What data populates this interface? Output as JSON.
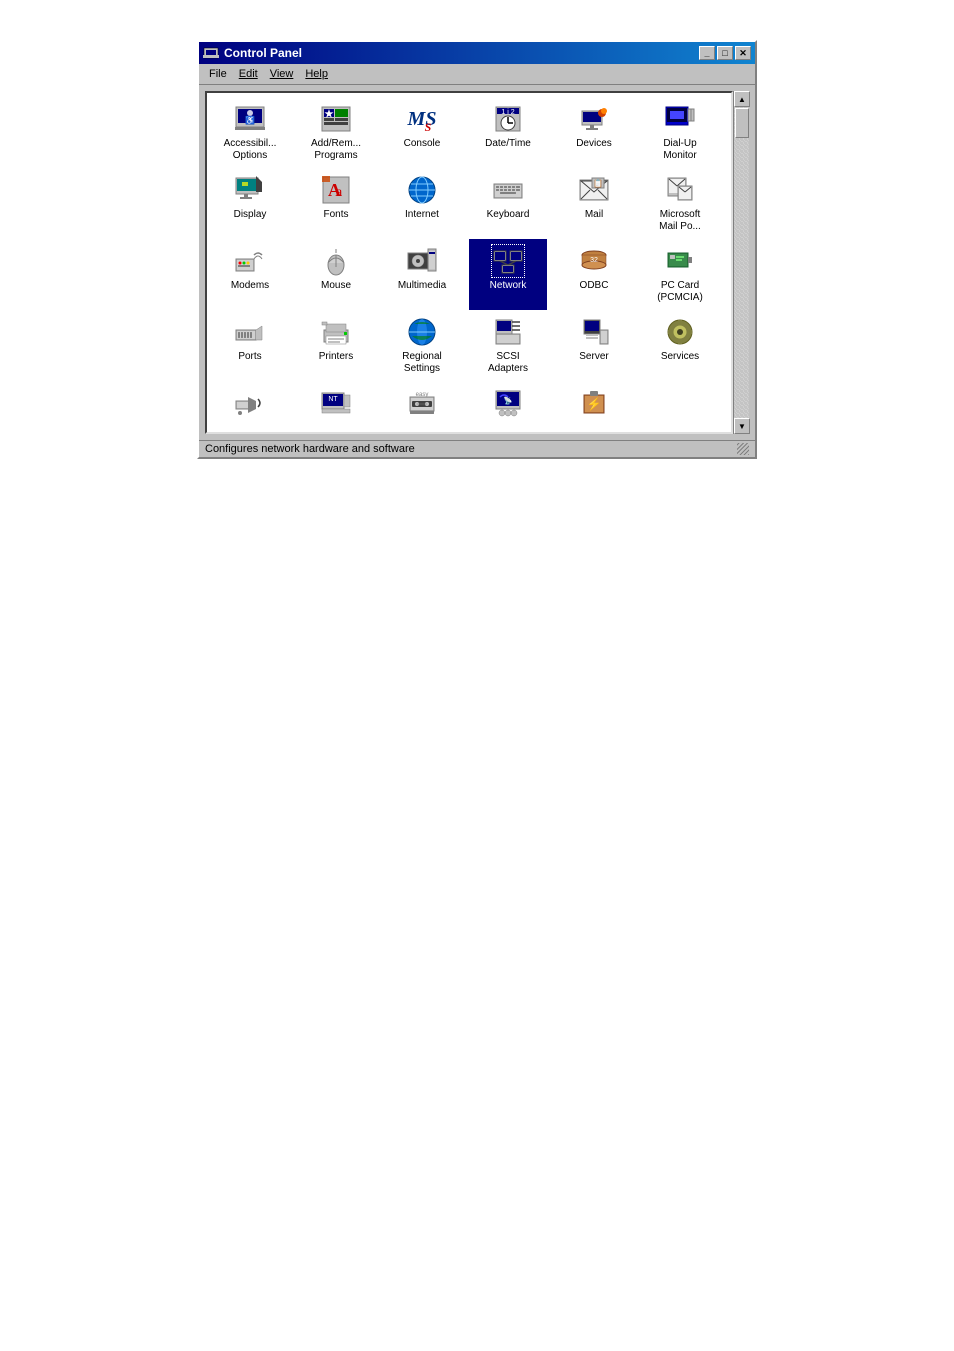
{
  "window": {
    "title": "Control Panel",
    "title_icon": "🖥",
    "min_btn": "_",
    "max_btn": "□",
    "close_btn": "✕"
  },
  "menu": {
    "items": [
      "File",
      "Edit",
      "View",
      "Help"
    ]
  },
  "icons": [
    {
      "id": "accessibility",
      "label": "Accessibil...\nOptions",
      "selected": false
    },
    {
      "id": "add-remove",
      "label": "Add/Rem...\nPrograms",
      "selected": false
    },
    {
      "id": "console",
      "label": "Console",
      "selected": false
    },
    {
      "id": "datetime",
      "label": "Date/Time",
      "selected": false
    },
    {
      "id": "devices",
      "label": "Devices",
      "selected": false
    },
    {
      "id": "dialup",
      "label": "Dial-Up\nMonitor",
      "selected": false
    },
    {
      "id": "display",
      "label": "Display",
      "selected": false
    },
    {
      "id": "fonts",
      "label": "Fonts",
      "selected": false
    },
    {
      "id": "internet",
      "label": "Internet",
      "selected": false
    },
    {
      "id": "keyboard",
      "label": "Keyboard",
      "selected": false
    },
    {
      "id": "mail",
      "label": "Mail",
      "selected": false
    },
    {
      "id": "ms-mail",
      "label": "Microsoft\nMail Po...",
      "selected": false
    },
    {
      "id": "modems",
      "label": "Modems",
      "selected": false
    },
    {
      "id": "mouse",
      "label": "Mouse",
      "selected": false
    },
    {
      "id": "multimedia",
      "label": "Multimedia",
      "selected": false
    },
    {
      "id": "network",
      "label": "Network",
      "selected": true
    },
    {
      "id": "odbc",
      "label": "ODBC",
      "selected": false
    },
    {
      "id": "pccard",
      "label": "PC Card\n(PCMCIA)",
      "selected": false
    },
    {
      "id": "ports",
      "label": "Ports",
      "selected": false
    },
    {
      "id": "printers",
      "label": "Printers",
      "selected": false
    },
    {
      "id": "regional",
      "label": "Regional\nSettings",
      "selected": false
    },
    {
      "id": "scsi",
      "label": "SCSI\nAdapters",
      "selected": false
    },
    {
      "id": "server",
      "label": "Server",
      "selected": false
    },
    {
      "id": "services",
      "label": "Services",
      "selected": false
    },
    {
      "id": "sounds",
      "label": "",
      "selected": false
    },
    {
      "id": "system",
      "label": "",
      "selected": false
    },
    {
      "id": "tape",
      "label": "",
      "selected": false
    },
    {
      "id": "telephony",
      "label": "",
      "selected": false
    },
    {
      "id": "ups",
      "label": "",
      "selected": false
    }
  ],
  "status": {
    "text": "Configures network hardware and software"
  }
}
